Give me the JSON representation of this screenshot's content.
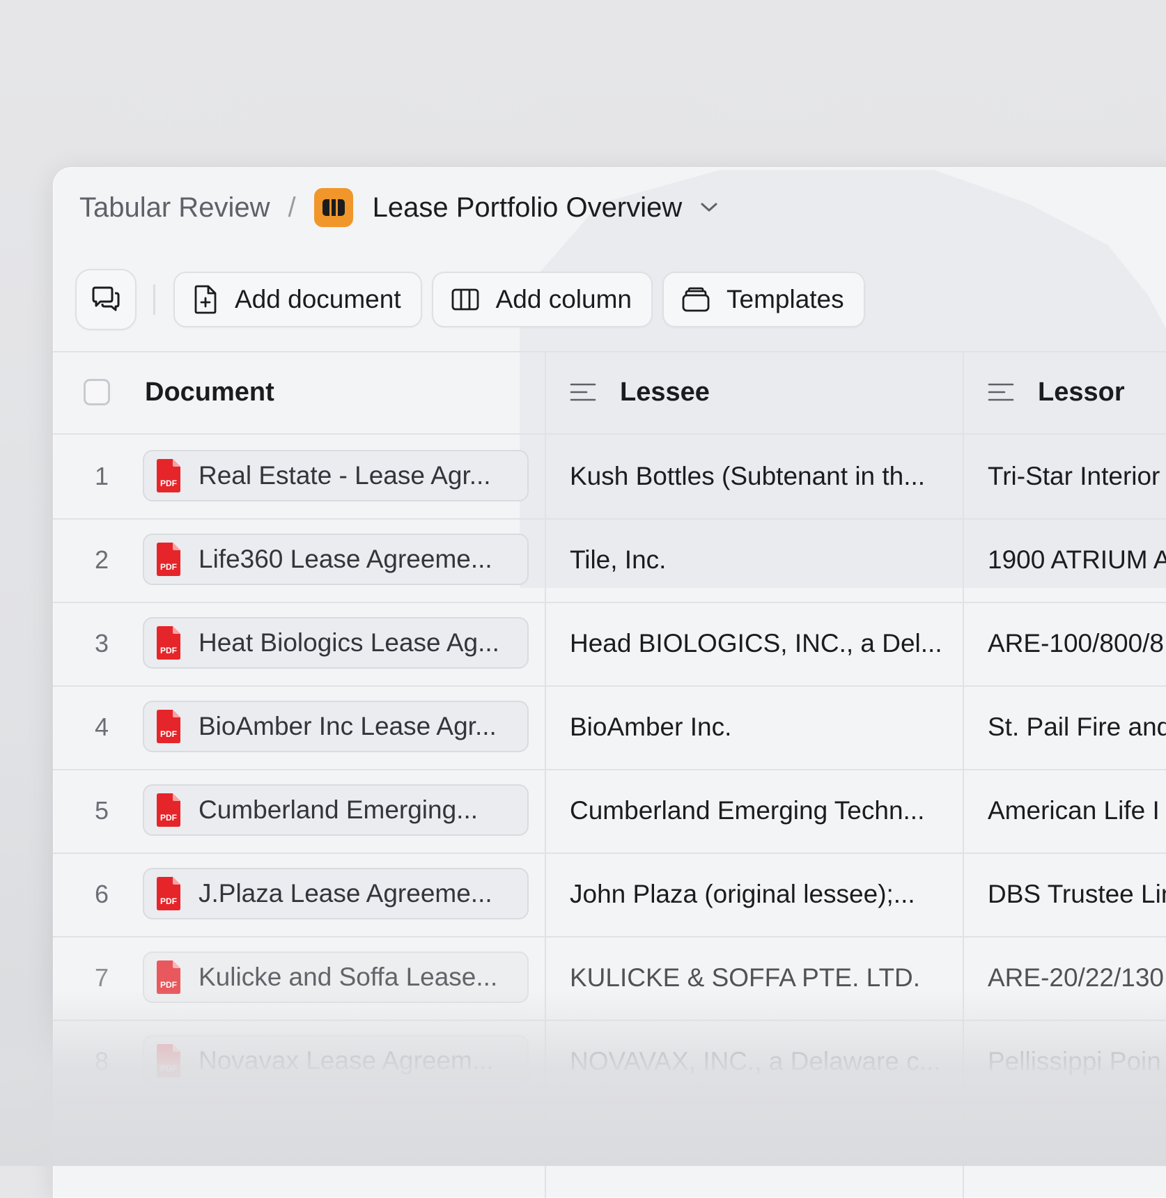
{
  "breadcrumb": {
    "root": "Tabular Review",
    "separator": "/",
    "title": "Lease Portfolio Overview",
    "app_icon": "columns-icon",
    "app_icon_color": "#f0962b"
  },
  "toolbar": {
    "chat_icon": "chat-bubbles-icon",
    "add_document_label": "Add document",
    "add_column_label": "Add column",
    "templates_label": "Templates"
  },
  "table": {
    "columns": {
      "document": "Document",
      "lessee": "Lessee",
      "lessor": "Lessor"
    },
    "rows": [
      {
        "num": "1",
        "document": "Real Estate - Lease Agr...",
        "lessee": "Kush Bottles (Subtenant in th...",
        "lessor": "Tri-Star Interior"
      },
      {
        "num": "2",
        "document": "Life360 Lease Agreeme...",
        "lessee": "Tile, Inc.",
        "lessor": "1900 ATRIUM A"
      },
      {
        "num": "3",
        "document": "Heat Biologics Lease Ag...",
        "lessee": "Head BIOLOGICS, INC., a Del...",
        "lessor": "ARE-100/800/8"
      },
      {
        "num": "4",
        "document": "BioAmber Inc Lease Agr...",
        "lessee": "BioAmber Inc.",
        "lessor": "St. Pail Fire and"
      },
      {
        "num": "5",
        "document": "Cumberland Emerging...",
        "lessee": "Cumberland Emerging Techn...",
        "lessor": "American Life I"
      },
      {
        "num": "6",
        "document": "J.Plaza Lease Agreeme...",
        "lessee": "John Plaza (original lessee);...",
        "lessor": "DBS Trustee Lin"
      },
      {
        "num": "7",
        "document": "Kulicke and Soffa Lease...",
        "lessee": "KULICKE & SOFFA PTE. LTD.",
        "lessor": "ARE-20/22/130"
      },
      {
        "num": "8",
        "document": "Novavax Lease Agreem...",
        "lessee": "NOVAVAX, INC., a Delaware c...",
        "lessor": "Pellissippi Poin"
      }
    ],
    "pdf_label": "PDF",
    "pdf_color": "#e5252a"
  }
}
